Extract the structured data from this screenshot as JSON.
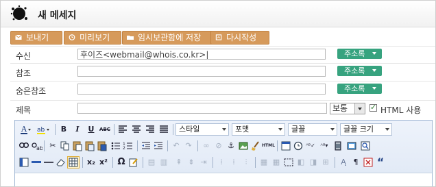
{
  "window": {
    "title": "새 메세지"
  },
  "actions": [
    {
      "label": "보내기",
      "icon": "envelope-icon"
    },
    {
      "label": "미리보기",
      "icon": "clock-icon"
    },
    {
      "label": "임시보관함에 저장",
      "icon": "folder-icon"
    },
    {
      "label": "다시작성",
      "icon": "document-icon"
    }
  ],
  "fields": {
    "to": {
      "label": "수신",
      "value": "후이즈<webmail@whois.co.kr>|",
      "addressbook": "주소록"
    },
    "cc": {
      "label": "참조",
      "value": "",
      "addressbook": "주소록"
    },
    "bcc": {
      "label": "숨은참조",
      "value": "",
      "addressbook": "주소록"
    },
    "subject": {
      "label": "제목",
      "value": "",
      "priority": "보통",
      "html_label": "HTML 사용",
      "html_checked": true
    }
  },
  "editor": {
    "dropdowns": {
      "style": "스타일",
      "format": "포맷",
      "font": "글꼴",
      "size": "글꼴 크기"
    },
    "toolbar_icons": [
      "text-color-icon",
      "highlight-icon",
      "bold-icon",
      "italic-icon",
      "underline-icon",
      "strikethrough-icon",
      "align-left-icon",
      "align-center-icon",
      "align-right-icon",
      "justify-icon",
      "find-icon",
      "replace-icon",
      "cut-icon",
      "copy-icon",
      "paste-icon",
      "paste-text-icon",
      "paste-word-icon",
      "bullet-list-icon",
      "number-list-icon",
      "outdent-icon",
      "indent-icon",
      "undo-icon",
      "redo-icon",
      "link-icon",
      "unlink-icon",
      "anchor-icon",
      "image-icon",
      "cleanup-icon",
      "html-icon",
      "date-icon",
      "time-icon",
      "spellcheck-icon",
      "abc-icon",
      "media-icon",
      "fullscreen-icon",
      "zoom-icon",
      "layer-icon",
      "hr-icon",
      "line-icon",
      "eraser-icon",
      "table-icon",
      "subscript-icon",
      "superscript-icon",
      "omega-icon",
      "edit-icon",
      "visual-aid-icon",
      "pilcrow-icon",
      "blockquote-icon"
    ],
    "labels": {
      "bold": "B",
      "italic": "I",
      "underline": "U",
      "strike": "ABC",
      "html": "HTML",
      "sub": "x₂",
      "sup": "x²",
      "omega": "Ω",
      "pilcrow": "¶",
      "quote": "“"
    }
  }
}
